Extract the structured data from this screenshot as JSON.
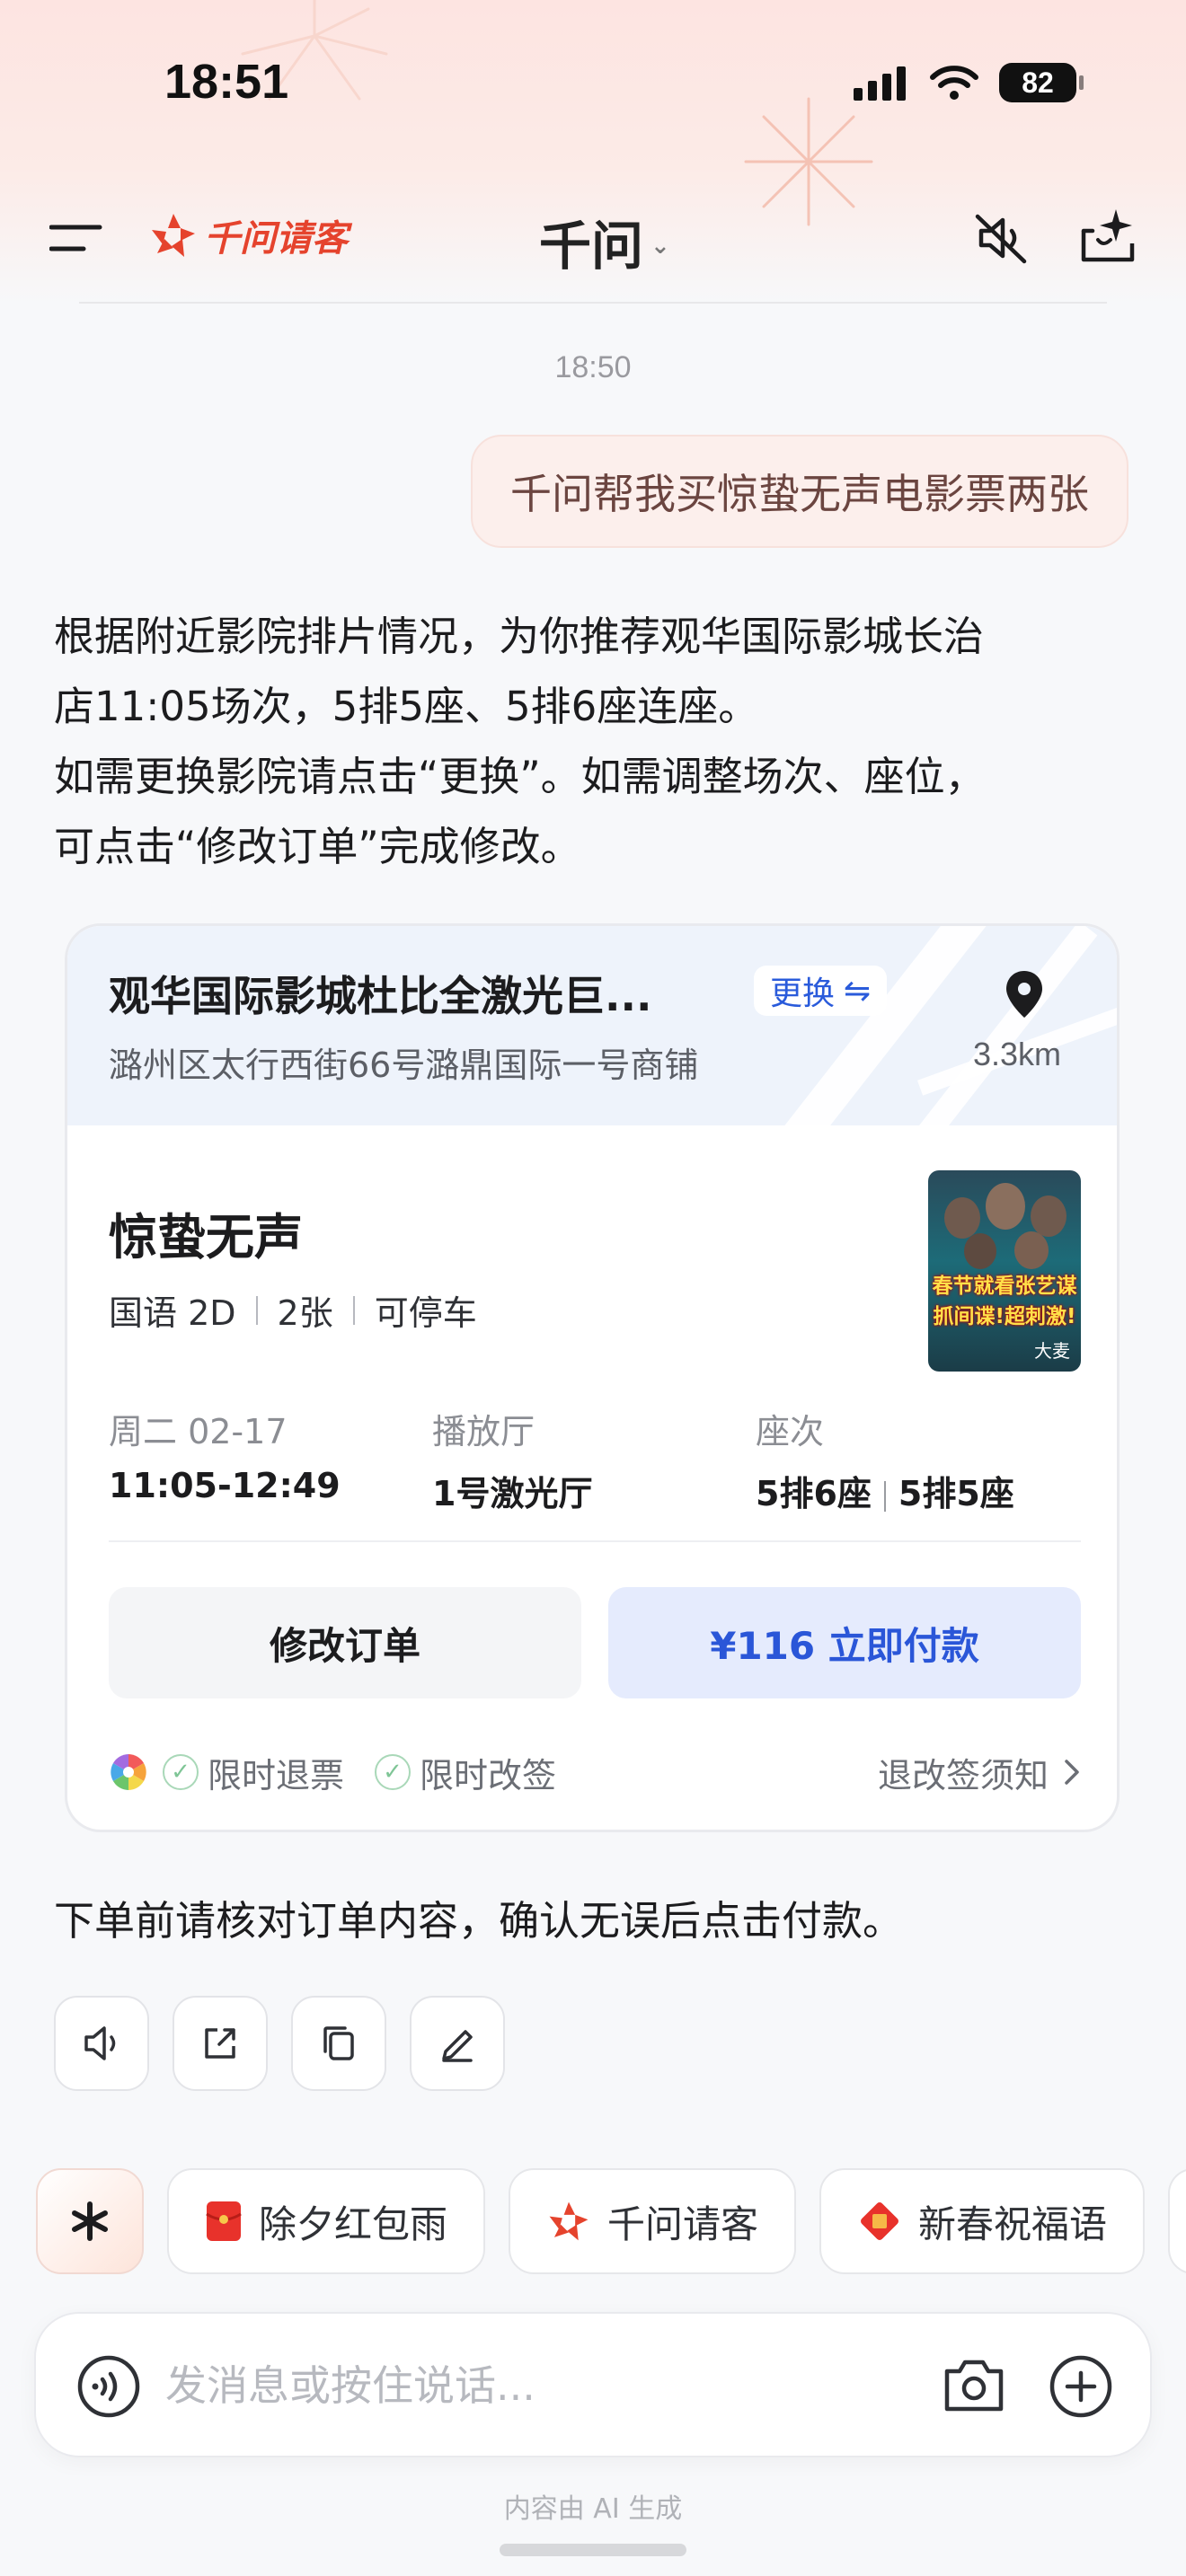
{
  "status_bar": {
    "time": "18:51",
    "battery": "82"
  },
  "header": {
    "brand_name": "千问请客",
    "title": "千问",
    "colors": {
      "brand": "#e5432d"
    }
  },
  "chat": {
    "timestamp": "18:50",
    "user_message": "千问帮我买惊蛰无声电影票两张",
    "ai_lines": [
      "根据附近影院排片情况，为你推荐观华国际影城长治",
      "店11:05场次，5排5座、5排6座连座。",
      "如需更换影院请点击“更换”。如需调整场次、座位，",
      "可点击“修改订单”完成修改。"
    ],
    "confirm_text": "下单前请核对订单内容，确认无误后点击付款。"
  },
  "ticket_card": {
    "cinema_name": "观华国际影城杜比全激光巨...",
    "change_label": "更换",
    "address": "潞州区太行西街66号潞鼎国际一号商铺",
    "distance": "3.3km",
    "movie_title": "惊蛰无声",
    "meta": [
      "国语 2D",
      "2张",
      "可停车"
    ],
    "poster_text": [
      "春节就看张艺谋",
      "抓间谍!超刺激!"
    ],
    "poster_logo": "大麦",
    "date_label": "周二 02-17",
    "time_range": "11:05-12:49",
    "hall_label": "播放厅",
    "hall_value": "1号激光厅",
    "seat_label": "座次",
    "seats": [
      "5排6座",
      "5排5座"
    ],
    "modify_label": "修改订单",
    "pay_label": "¥116 立即付款",
    "policies": [
      "限时退票",
      "限时改签"
    ],
    "policy_link": "退改签须知"
  },
  "chips": [
    {
      "label": "除夕红包雨",
      "icon": "red-envelope-icon"
    },
    {
      "label": "千问请客",
      "icon": "qianwen-logo-icon"
    },
    {
      "label": "新春祝福语",
      "icon": "fu-icon"
    }
  ],
  "input": {
    "placeholder": "发消息或按住说话..."
  },
  "footer_note": "内容由 AI 生成"
}
